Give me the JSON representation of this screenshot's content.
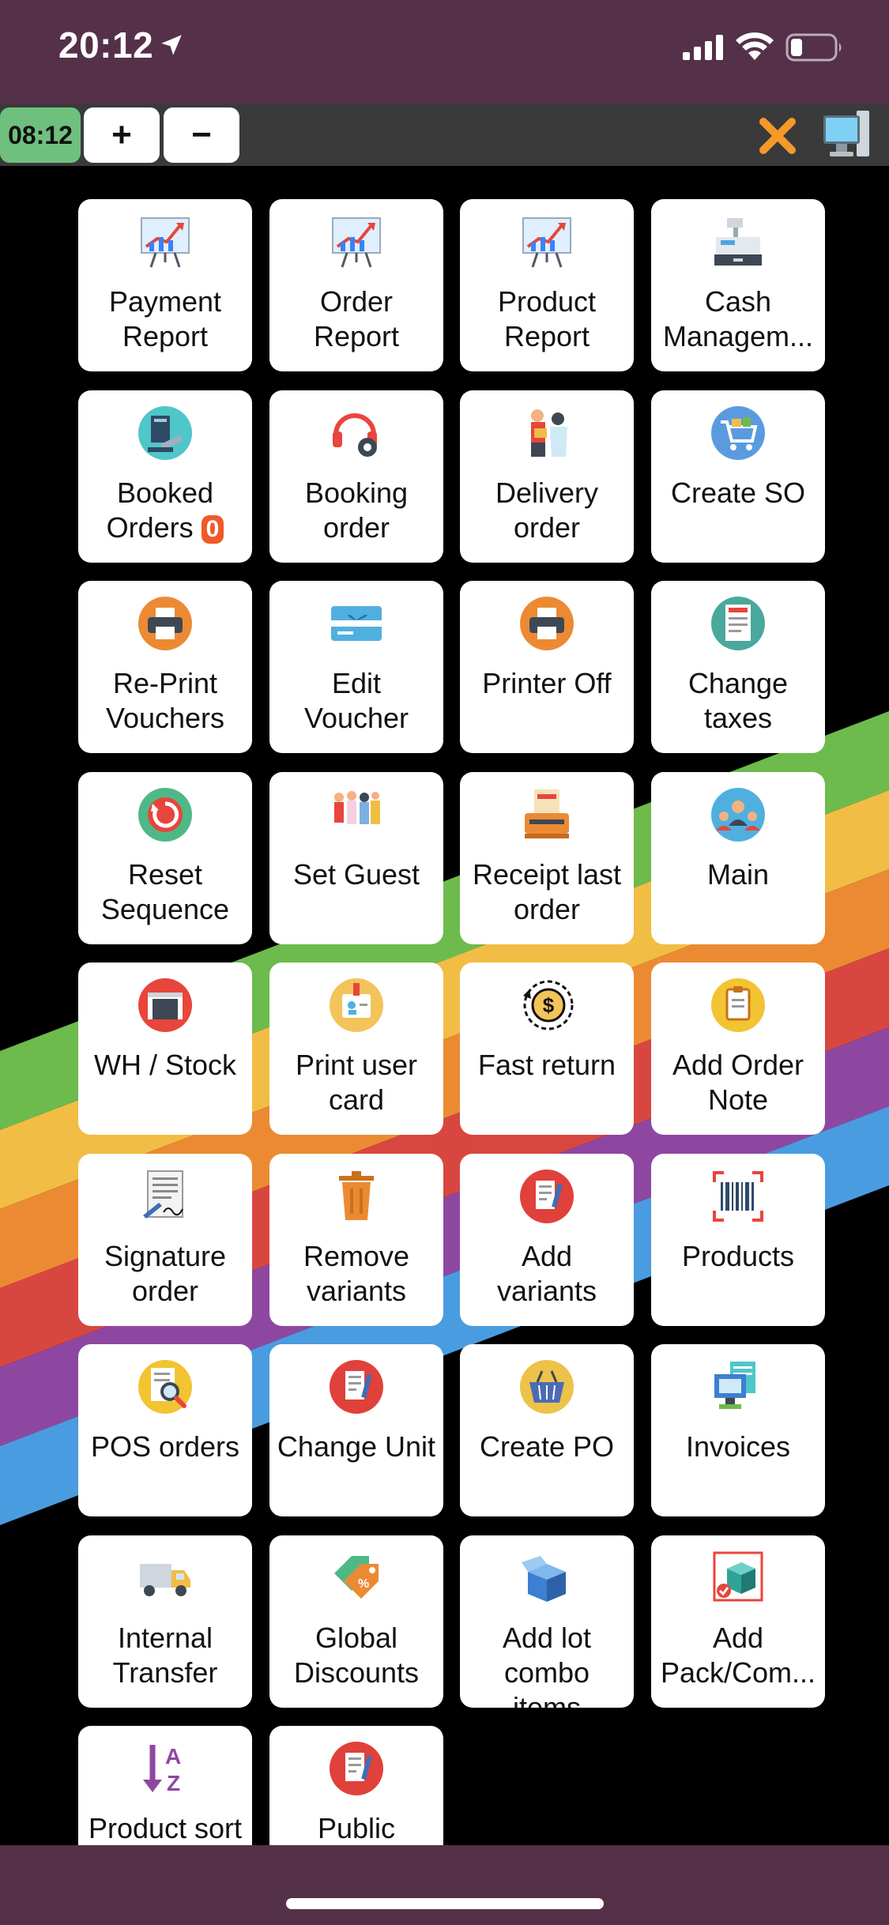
{
  "status": {
    "time": "20:12"
  },
  "toolbar": {
    "clock": "08:12",
    "plus": "+",
    "minus": "−"
  },
  "tiles": [
    {
      "label": "Payment\nReport",
      "icon": "chart-icon"
    },
    {
      "label": "Order\nReport",
      "icon": "chart-icon"
    },
    {
      "label": "Product\nReport",
      "icon": "chart-icon"
    },
    {
      "label": "Cash\nManagem...",
      "icon": "cash-register-icon"
    },
    {
      "label": "Booked\nOrders",
      "badge": "0",
      "icon": "booked-orders-icon"
    },
    {
      "label": "Booking\norder",
      "icon": "headset-icon"
    },
    {
      "label": "Delivery\norder",
      "icon": "delivery-person-icon"
    },
    {
      "label": "Create SO",
      "icon": "shopping-cart-icon"
    },
    {
      "label": "Re-Print\nVouchers",
      "icon": "printer-icon"
    },
    {
      "label": "Edit\nVoucher",
      "icon": "gift-card-icon"
    },
    {
      "label": "Printer Off",
      "icon": "printer-icon"
    },
    {
      "label": "Change\ntaxes",
      "icon": "tax-document-icon"
    },
    {
      "label": "Reset\nSequence",
      "icon": "reset-icon"
    },
    {
      "label": "Set Guest",
      "icon": "guests-icon"
    },
    {
      "label": "Receipt last\norder",
      "icon": "receipt-icon"
    },
    {
      "label": "Main",
      "icon": "team-icon"
    },
    {
      "label": "WH / Stock",
      "icon": "warehouse-icon"
    },
    {
      "label": "Print user\ncard",
      "icon": "id-card-icon"
    },
    {
      "label": "Fast return",
      "icon": "money-return-icon"
    },
    {
      "label": "Add Order\nNote",
      "icon": "clipboard-icon"
    },
    {
      "label": "Signature\norder",
      "icon": "signature-icon"
    },
    {
      "label": "Remove\nvariants",
      "icon": "trash-icon"
    },
    {
      "label": "Add\nvariants",
      "icon": "document-pen-icon"
    },
    {
      "label": "Products",
      "icon": "barcode-icon"
    },
    {
      "label": "POS orders",
      "icon": "search-document-icon"
    },
    {
      "label": "Change Unit",
      "icon": "document-pen-icon"
    },
    {
      "label": "Create PO",
      "icon": "basket-icon"
    },
    {
      "label": "Invoices",
      "icon": "invoices-icon"
    },
    {
      "label": "Internal\nTransfer",
      "icon": "truck-icon"
    },
    {
      "label": "Global\nDiscounts",
      "icon": "discount-tag-icon"
    },
    {
      "label": "Add lot\ncombo\nitems",
      "icon": "box-icon"
    },
    {
      "label": "Add\nPack/Com...",
      "icon": "package-icon"
    },
    {
      "label": "Product sort",
      "icon": "sort-az-icon"
    },
    {
      "label": "Public",
      "icon": "document-pen-icon"
    }
  ],
  "colors": {
    "status_bg": "#553049",
    "toolbar_bg": "#3a3a3a",
    "clock_bg": "#6fc07f",
    "close": "#f39a2b",
    "stripes": [
      "#6dbb4d",
      "#f2bd44",
      "#ec8a34",
      "#d8473f",
      "#8e47a0",
      "#4a9ce0"
    ]
  }
}
